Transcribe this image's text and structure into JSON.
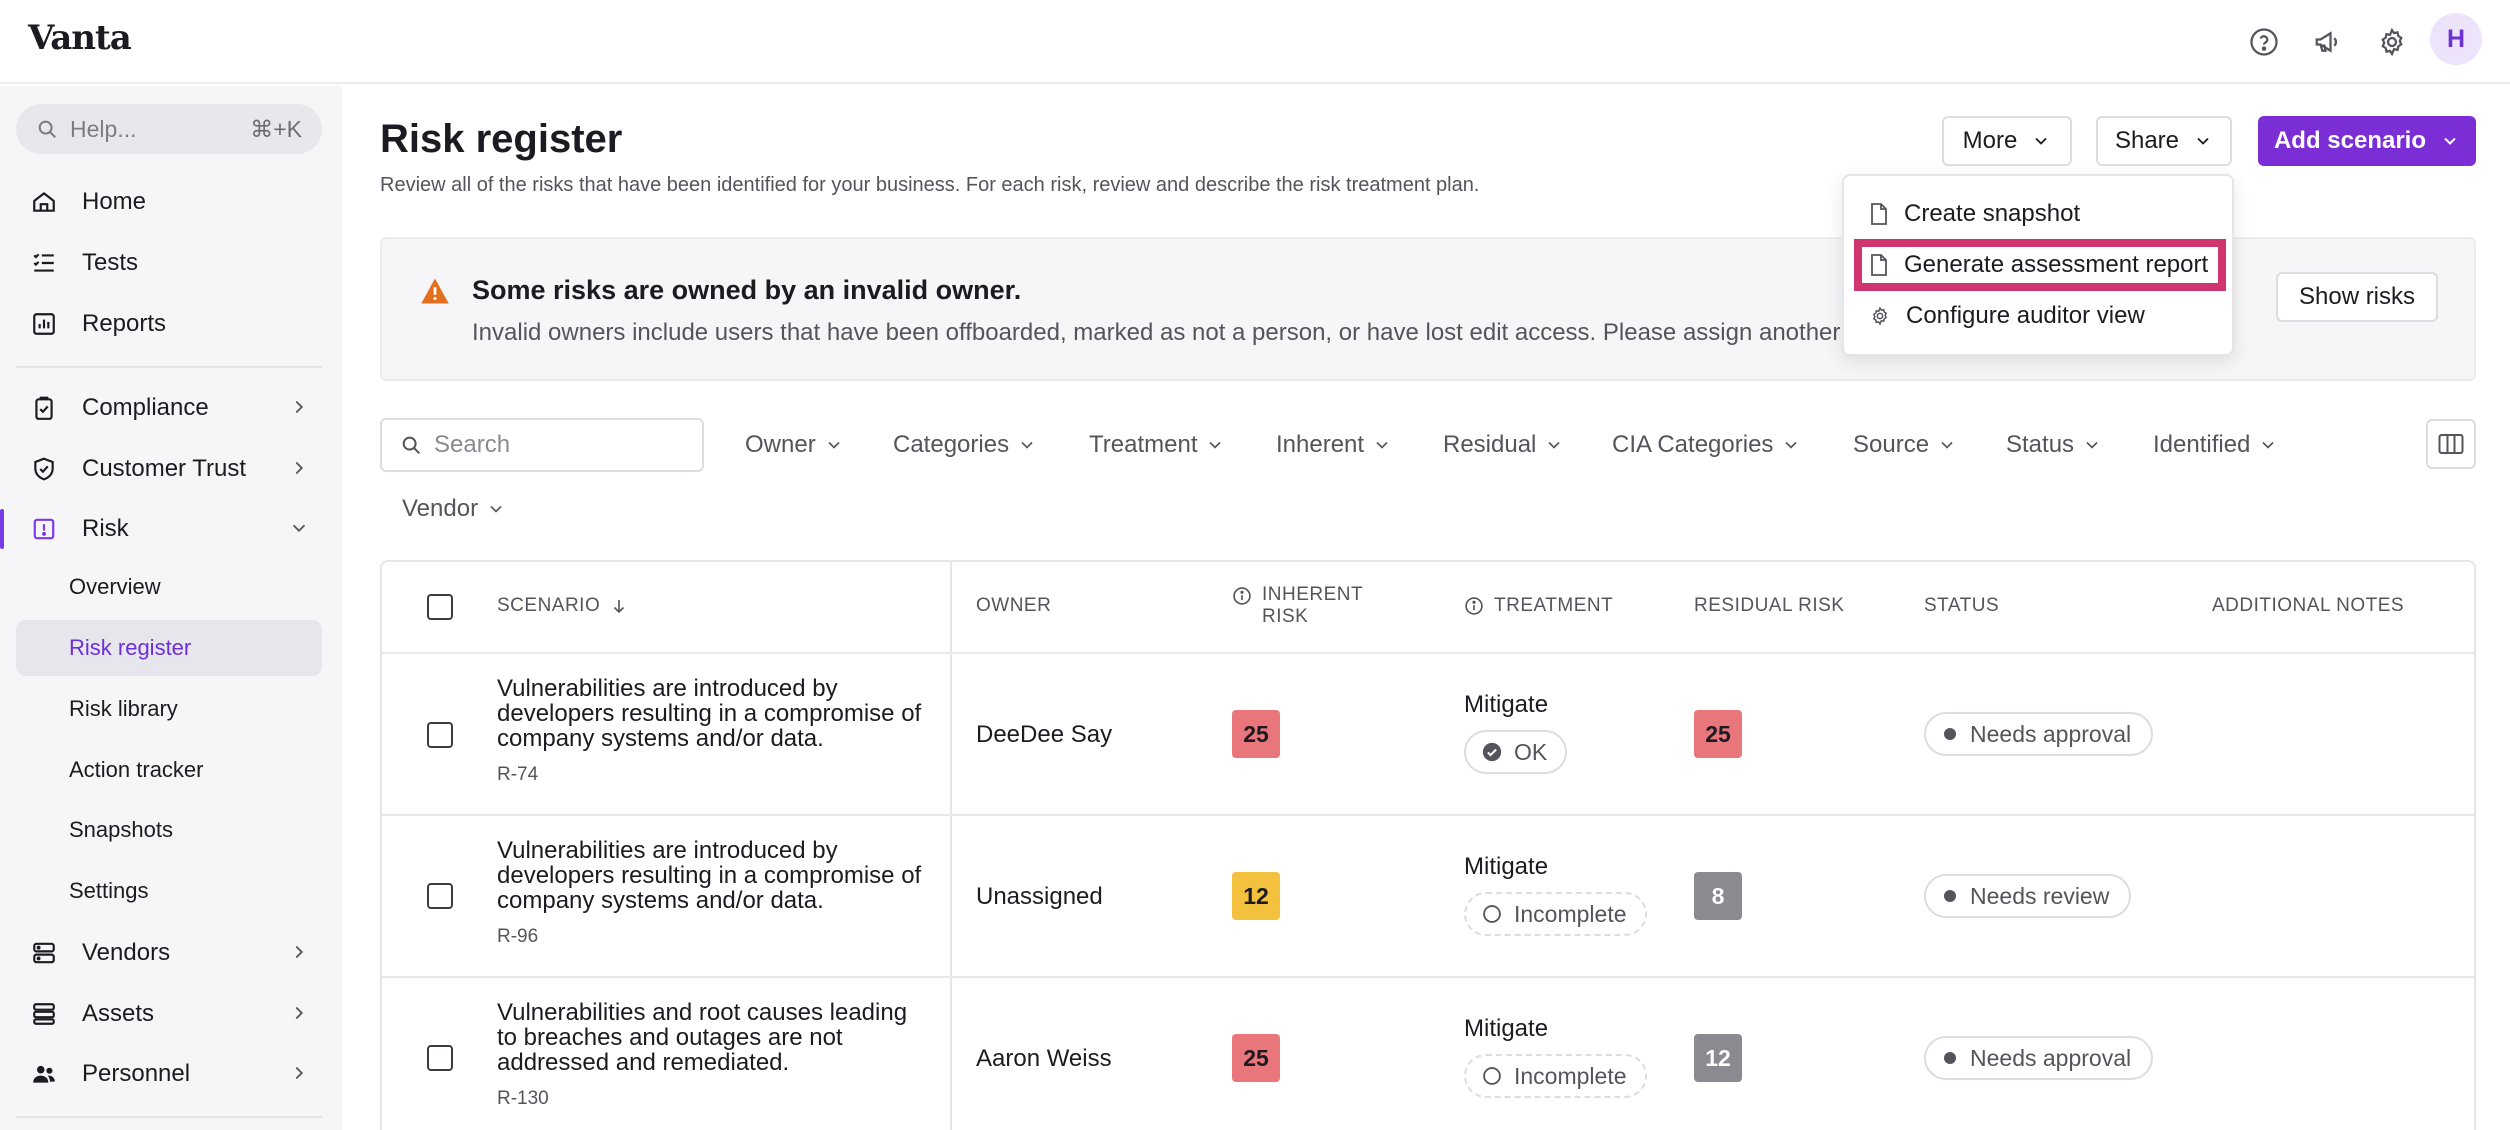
{
  "app": {
    "logo": "Vanta",
    "avatar_initial": "H"
  },
  "topbar_icons": [
    "help-circle-icon",
    "megaphone-icon",
    "gear-icon"
  ],
  "sidebar": {
    "help_placeholder": "Help...",
    "help_shortcut": "⌘+K",
    "items": [
      {
        "label": "Home",
        "icon": "home-icon"
      },
      {
        "label": "Tests",
        "icon": "list-check-icon"
      },
      {
        "label": "Reports",
        "icon": "chart-icon"
      },
      {
        "label": "Compliance",
        "icon": "clipboard-icon"
      },
      {
        "label": "Customer Trust",
        "icon": "shield-icon"
      },
      {
        "label": "Risk",
        "icon": "alert-square-icon"
      },
      {
        "label": "Vendors",
        "icon": "server-icon"
      },
      {
        "label": "Assets",
        "icon": "stack-icon"
      },
      {
        "label": "Personnel",
        "icon": "people-icon"
      }
    ],
    "risk_sub": [
      "Overview",
      "Risk register",
      "Risk library",
      "Action tracker",
      "Snapshots",
      "Settings"
    ]
  },
  "page": {
    "title": "Risk register",
    "subtitle": "Review all of the risks that have been identified for your business. For each risk, review and describe the risk treatment plan.",
    "more_label": "More",
    "share_label": "Share",
    "add_label": "Add scenario"
  },
  "alert": {
    "title": "Some risks are owned by an invalid owner.",
    "text": "Invalid owners include users that have been offboarded, marked as not a person, or have lost edit access. Please assign another owner.",
    "button": "Show risks"
  },
  "menu": {
    "items": [
      "Create snapshot",
      "Generate assessment report",
      "Configure auditor view"
    ]
  },
  "filters": {
    "search_placeholder": "Search",
    "items": [
      "Owner",
      "Categories",
      "Treatment",
      "Inherent",
      "Residual",
      "CIA Categories",
      "Source",
      "Status",
      "Identified",
      "Vendor"
    ]
  },
  "table": {
    "headers": {
      "scenario": "SCENARIO",
      "owner": "OWNER",
      "inherent": "INHERENT RISK",
      "treatment": "TREATMENT",
      "residual": "RESIDUAL RISK",
      "status": "STATUS",
      "notes": "ADDITIONAL NOTES"
    },
    "rows": [
      {
        "scenario": "Vulnerabilities are introduced by developers resulting in a compromise of company systems and/or data.",
        "id": "R-74",
        "owner": "DeeDee Say",
        "inherent": "25",
        "inherent_color": "#e8767a",
        "treatment": "Mitigate",
        "treatment_state": "OK",
        "residual": "25",
        "residual_color": "#e8767a",
        "status": "Needs approval"
      },
      {
        "scenario": "Vulnerabilities are introduced by developers resulting in a compromise of company systems and/or data.",
        "id": "R-96",
        "owner": "Unassigned",
        "inherent": "12",
        "inherent_color": "#f4c13e",
        "treatment": "Mitigate",
        "treatment_state": "Incomplete",
        "residual": "8",
        "residual_color": "#8b8a91",
        "status": "Needs review"
      },
      {
        "scenario": "Vulnerabilities and root causes leading to breaches and outages are not addressed and remediated.",
        "id": "R-130",
        "owner": "Aaron Weiss",
        "inherent": "25",
        "inherent_color": "#e8767a",
        "treatment": "Mitigate",
        "treatment_state": "Incomplete",
        "residual": "12",
        "residual_color": "#8b8a91",
        "status": "Needs approval"
      }
    ]
  }
}
